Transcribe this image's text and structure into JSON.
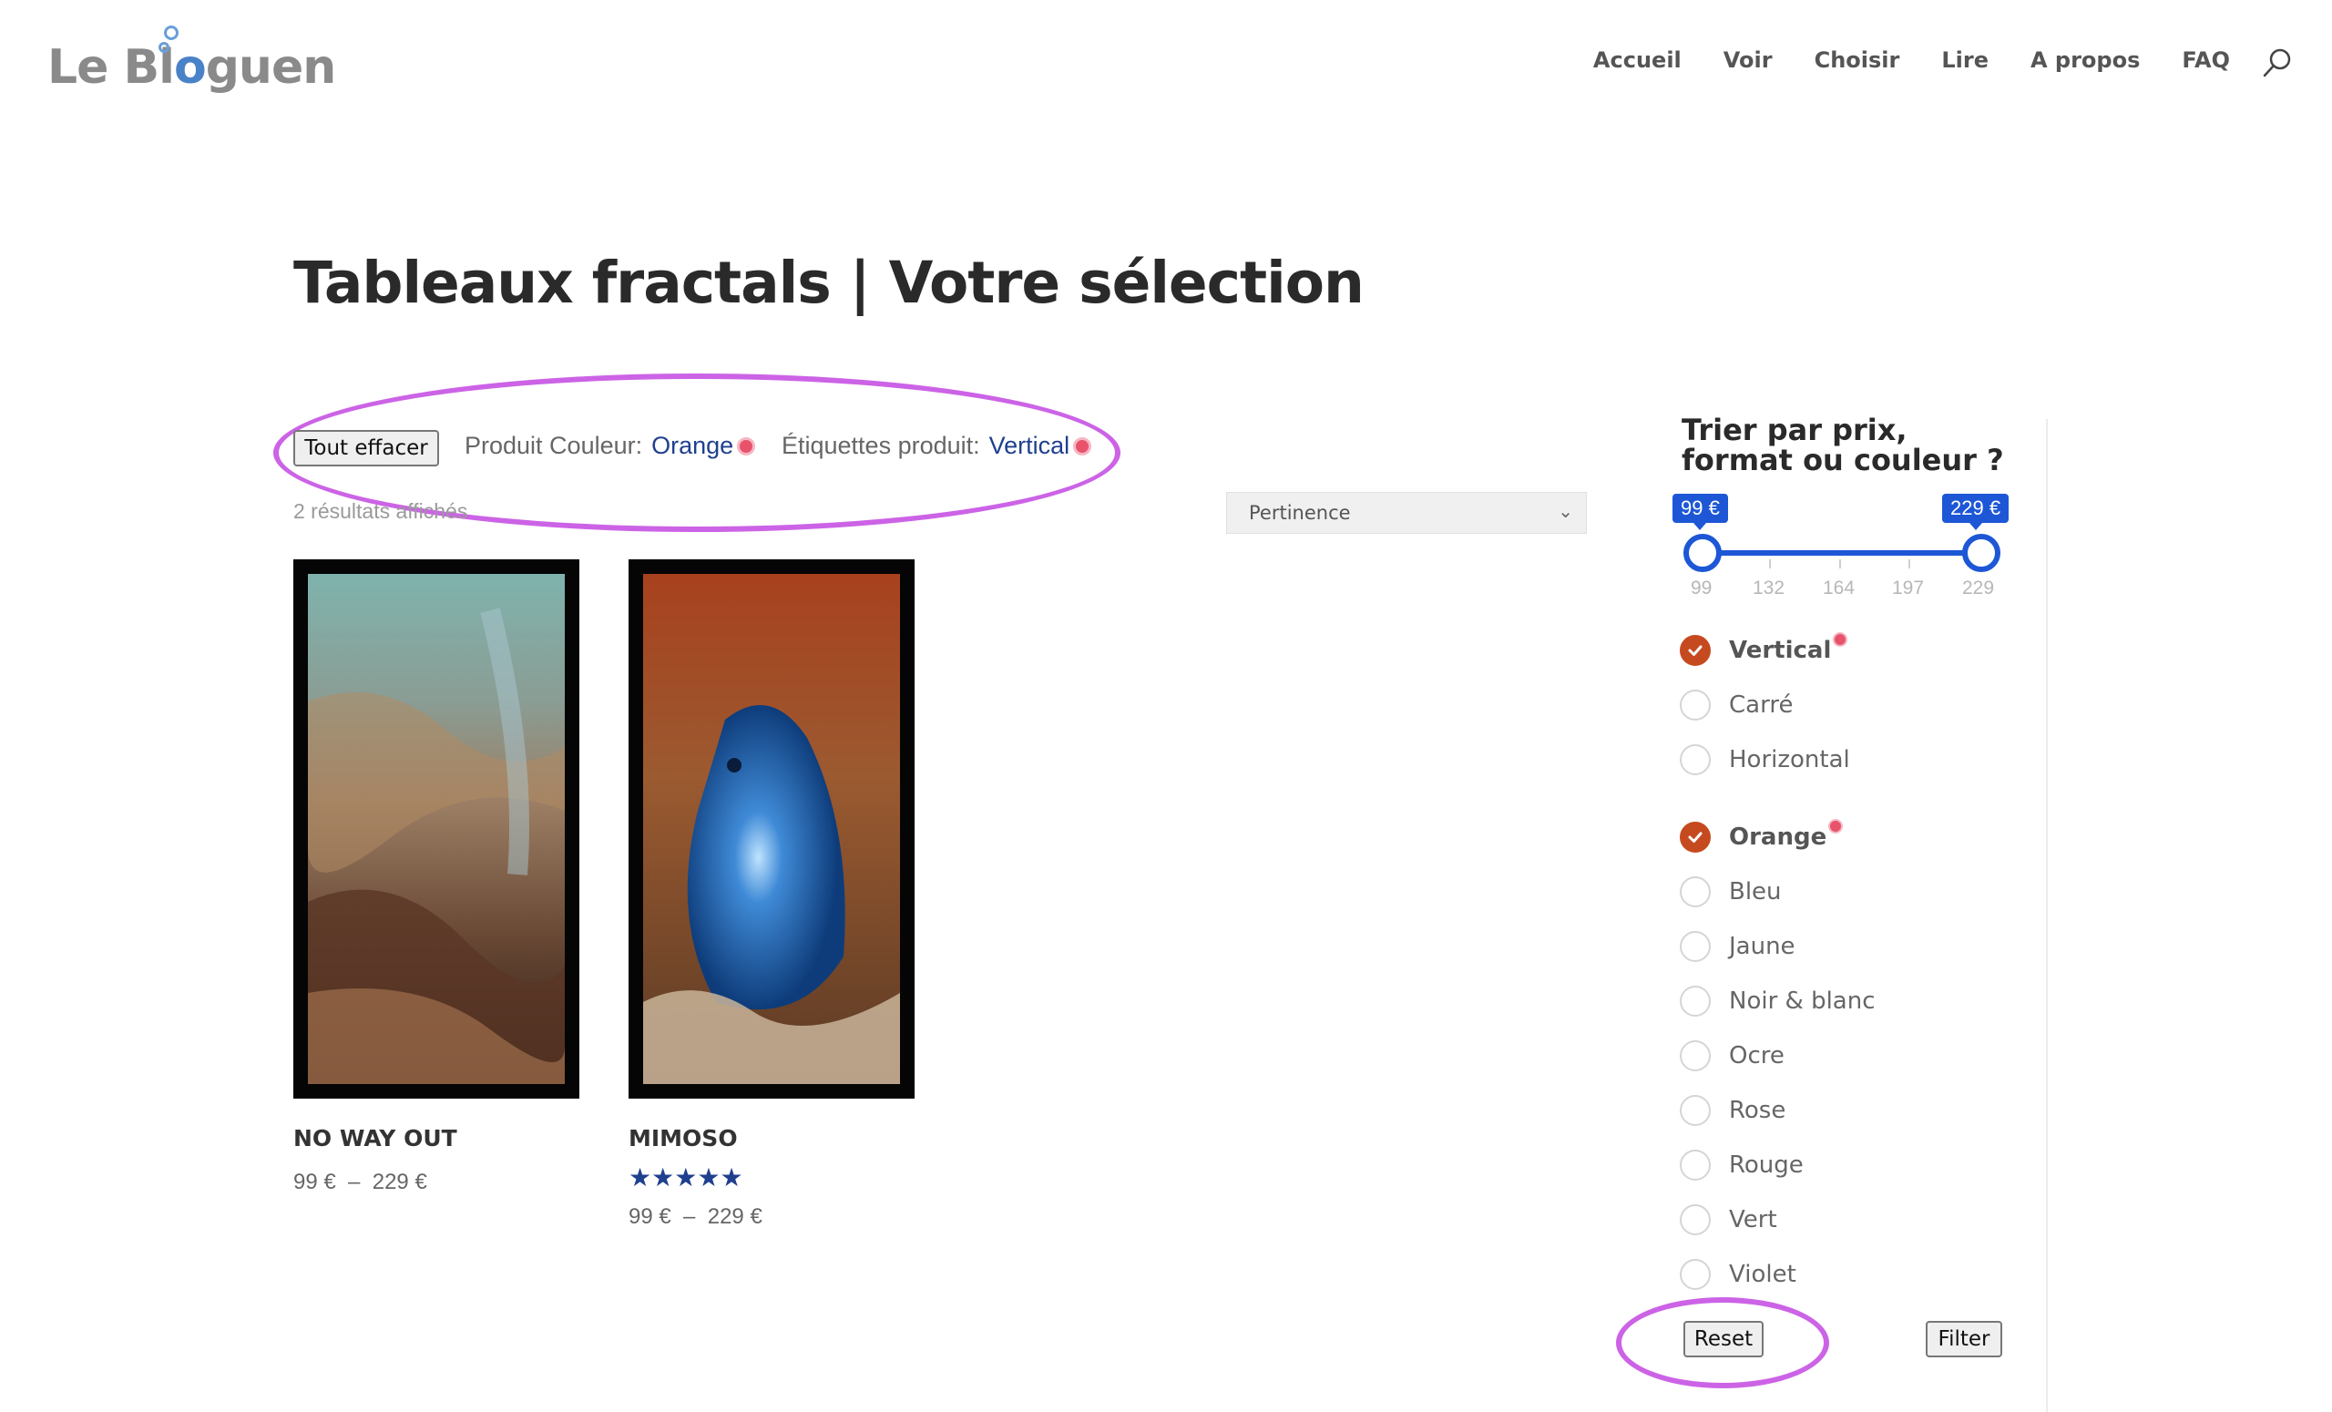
{
  "header": {
    "logo_text": "Le Bloguen",
    "nav": [
      "Accueil",
      "Voir",
      "Choisir",
      "Lire",
      "A propos",
      "FAQ"
    ]
  },
  "page_title": "Tableaux fractals | Votre sélection",
  "active_filters": {
    "clear_all_label": "Tout effacer",
    "items": [
      {
        "name": "Produit Couleur:",
        "value": "Orange"
      },
      {
        "name": "Étiquettes produit:",
        "value": "Vertical"
      }
    ]
  },
  "results": {
    "count_text": "2 résultats affichés",
    "sort_selected": "Pertinence"
  },
  "products": [
    {
      "name": "NO WAY OUT",
      "price": "99 €  –  229 €",
      "rating": 0
    },
    {
      "name": "MIMOSO",
      "price": "99 €  –  229 €",
      "rating": 5
    }
  ],
  "sidebar": {
    "title": "Trier par prix, format ou couleur ?",
    "price_slider": {
      "min_label": "99 €",
      "max_label": "229 €",
      "min_value": 99,
      "max_value": 229,
      "ticks": [
        "99",
        "132",
        "164",
        "197",
        "229"
      ]
    },
    "format_options": [
      {
        "label": "Vertical",
        "checked": true
      },
      {
        "label": "Carré",
        "checked": false
      },
      {
        "label": "Horizontal",
        "checked": false
      }
    ],
    "color_options": [
      {
        "label": "Orange",
        "checked": true
      },
      {
        "label": "Bleu",
        "checked": false
      },
      {
        "label": "Jaune",
        "checked": false
      },
      {
        "label": "Noir & blanc",
        "checked": false
      },
      {
        "label": "Ocre",
        "checked": false
      },
      {
        "label": "Rose",
        "checked": false
      },
      {
        "label": "Rouge",
        "checked": false
      },
      {
        "label": "Vert",
        "checked": false
      },
      {
        "label": "Violet",
        "checked": false
      }
    ],
    "reset_label": "Reset",
    "filter_label": "Filter"
  },
  "colors": {
    "accent_blue": "#1d57d6",
    "checked_orange": "#c64a1f",
    "annotation_purple": "#cc63e6",
    "filter_value_blue": "#1f3f8f"
  }
}
